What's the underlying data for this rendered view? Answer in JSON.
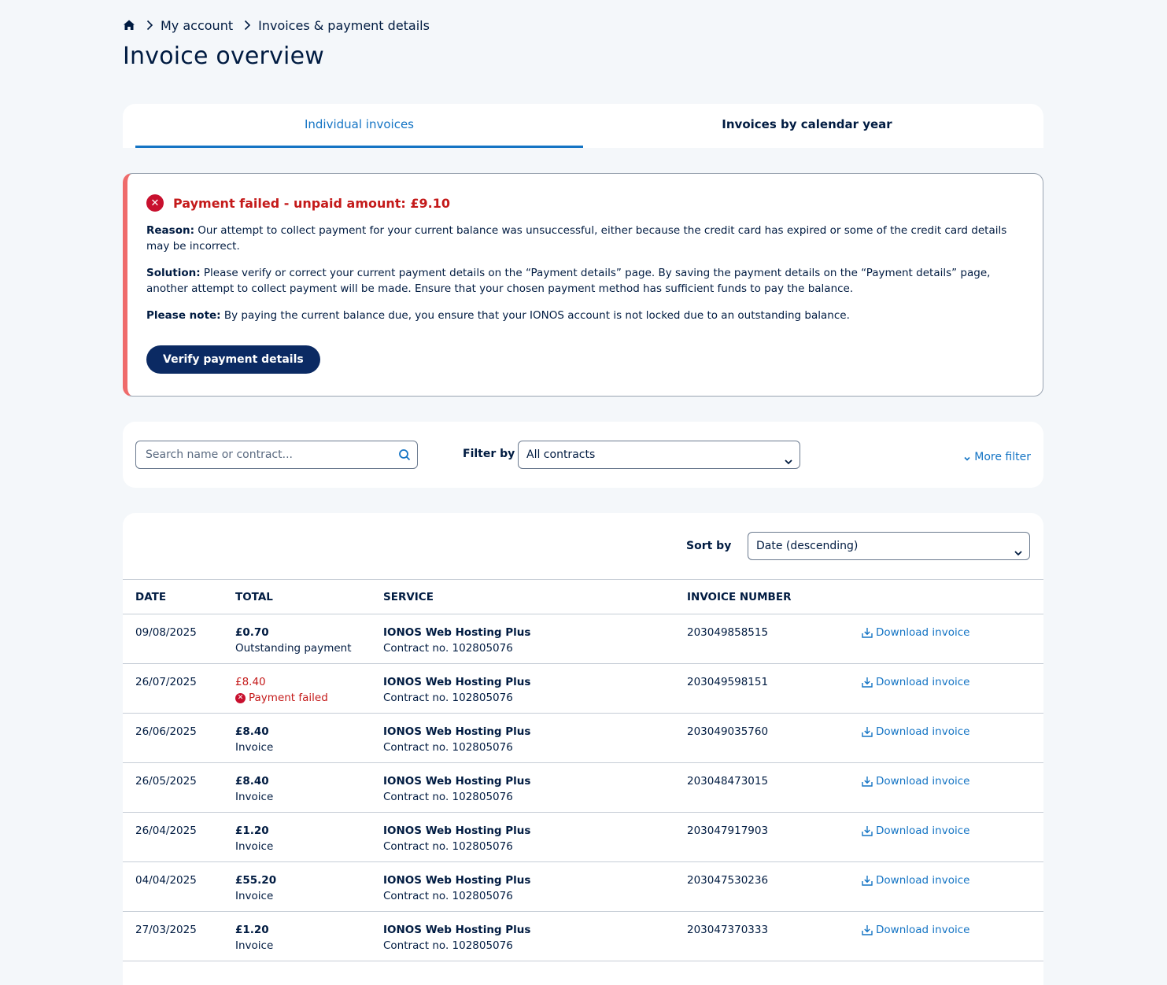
{
  "breadcrumb": {
    "home_icon": "home-icon",
    "items": [
      "My account",
      "Invoices & payment details"
    ]
  },
  "page_title": "Invoice overview",
  "tabs": [
    {
      "label": "Individual invoices",
      "active": true
    },
    {
      "label": "Invoices by calendar year",
      "active": false
    }
  ],
  "alert": {
    "title": "Payment failed - unpaid amount: £9.10",
    "reason_label": "Reason:",
    "reason_text": " Our attempt to collect payment for your current balance was unsuccessful, either because the credit card has expired or some of the credit card details may be incorrect.",
    "solution_label": "Solution:",
    "solution_text": " Please verify or correct your current payment details on the “Payment details” page. By saving the payment details on the “Payment details” page, another attempt to collect payment will be made. Ensure that your chosen payment method has sufficient funds to pay the balance.",
    "note_label": "Please note:",
    "note_text": " By paying the current balance due, you ensure that your IONOS account is not locked due to an outstanding balance.",
    "button_label": "Verify payment details",
    "accent_color": "#ef6b6b"
  },
  "filters": {
    "search_placeholder": "Search name or contract...",
    "filter_label": "Filter by",
    "filter_value": "All contracts",
    "more_filter_label": "More filter"
  },
  "sort": {
    "label": "Sort by",
    "value": "Date (descending)"
  },
  "table": {
    "headers": [
      "DATE",
      "TOTAL",
      "SERVICE",
      "INVOICE NUMBER",
      ""
    ],
    "download_label": "Download invoice",
    "rows": [
      {
        "date": "09/08/2025",
        "amount": "£0.70",
        "status": "Outstanding payment",
        "failed": false,
        "service": "IONOS Web Hosting Plus",
        "contract": "Contract no. 102805076",
        "invoice": "203049858515"
      },
      {
        "date": "26/07/2025",
        "amount": "£8.40",
        "status": "Payment failed",
        "failed": true,
        "service": "IONOS Web Hosting Plus",
        "contract": "Contract no. 102805076",
        "invoice": "203049598151"
      },
      {
        "date": "26/06/2025",
        "amount": "£8.40",
        "status": "Invoice",
        "failed": false,
        "service": "IONOS Web Hosting Plus",
        "contract": "Contract no. 102805076",
        "invoice": "203049035760"
      },
      {
        "date": "26/05/2025",
        "amount": "£8.40",
        "status": "Invoice",
        "failed": false,
        "service": "IONOS Web Hosting Plus",
        "contract": "Contract no. 102805076",
        "invoice": "203048473015"
      },
      {
        "date": "26/04/2025",
        "amount": "£1.20",
        "status": "Invoice",
        "failed": false,
        "service": "IONOS Web Hosting Plus",
        "contract": "Contract no. 102805076",
        "invoice": "203047917903"
      },
      {
        "date": "04/04/2025",
        "amount": "£55.20",
        "status": "Invoice",
        "failed": false,
        "service": "IONOS Web Hosting Plus",
        "contract": "Contract no. 102805076",
        "invoice": "203047530236"
      },
      {
        "date": "27/03/2025",
        "amount": "£1.20",
        "status": "Invoice",
        "failed": false,
        "service": "IONOS Web Hosting Plus",
        "contract": "Contract no. 102805076",
        "invoice": "203047370333"
      }
    ]
  }
}
